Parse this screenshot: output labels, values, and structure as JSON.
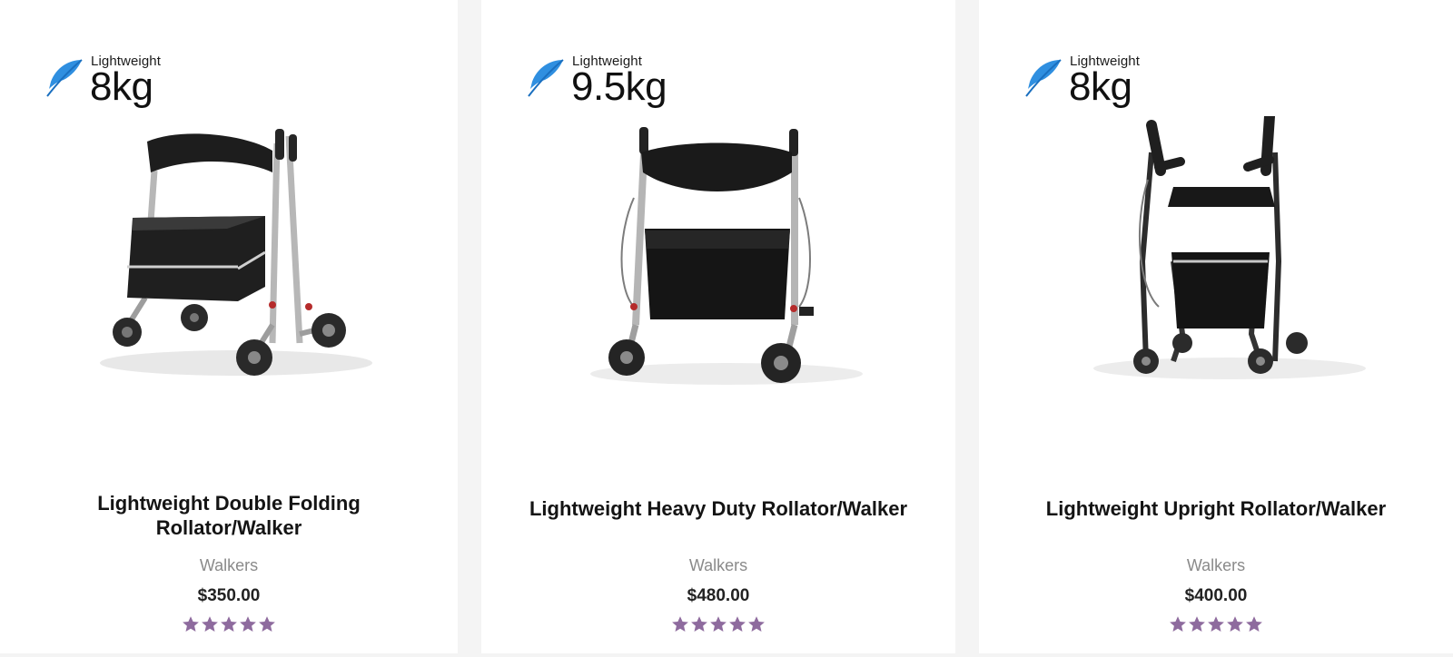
{
  "theme": {
    "star_color": "#8e6b9e",
    "feather_color": "#2f8fe0",
    "price_color": "#222222",
    "category_color": "#8a8a8a"
  },
  "products": [
    {
      "badge_label": "Lightweight",
      "badge_weight": "8kg",
      "title": "Lightweight Double Folding Rollator/Walker",
      "category": "Walkers",
      "price": "$350.00",
      "rating": 5
    },
    {
      "badge_label": "Lightweight",
      "badge_weight": "9.5kg",
      "title": "Lightweight Heavy Duty Rollator/Walker",
      "category": "Walkers",
      "price": "$480.00",
      "rating": 5
    },
    {
      "badge_label": "Lightweight",
      "badge_weight": "8kg",
      "title": "Lightweight Upright Rollator/Walker",
      "category": "Walkers",
      "price": "$400.00",
      "rating": 5
    }
  ],
  "icons": {
    "badge": "feather-icon",
    "rating": "star-icon"
  }
}
